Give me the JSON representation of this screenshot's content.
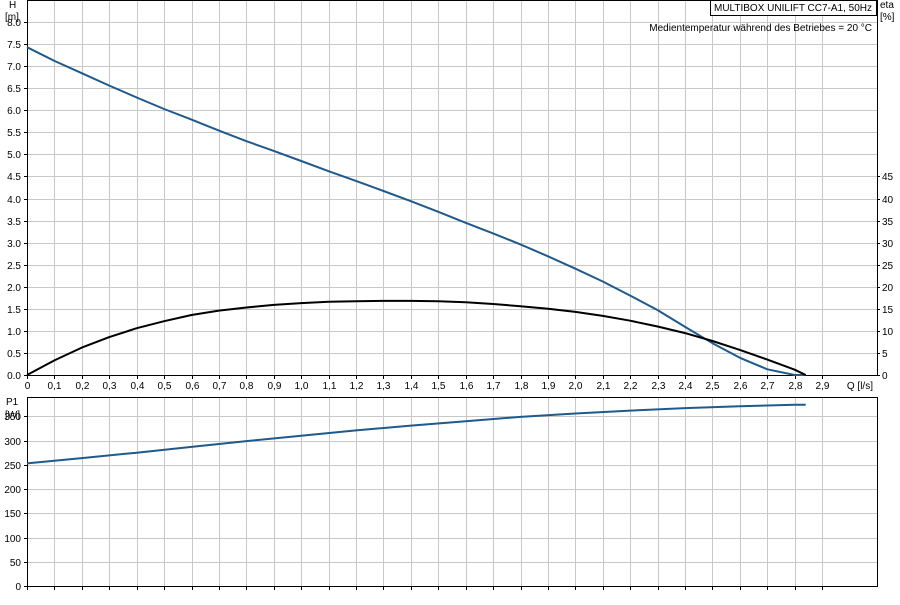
{
  "chart_data": [
    {
      "type": "line",
      "title_box": "MULTIBOX UNILIFT CC7-A1, 50Hz",
      "subtitle": "Medientemperatur während des Betriebes = 20 °C",
      "x_axis": {
        "label": "Q [l/s]",
        "range": [
          0,
          3.1
        ],
        "ticks": [
          0,
          0.1,
          0.2,
          0.3,
          0.4,
          0.5,
          0.6,
          0.7,
          0.8,
          0.9,
          1.0,
          1.1,
          1.2,
          1.3,
          1.4,
          1.5,
          1.6,
          1.7,
          1.8,
          1.9,
          2.0,
          2.1,
          2.2,
          2.3,
          2.4,
          2.5,
          2.6,
          2.7,
          2.8,
          2.9
        ],
        "tick_labels": [
          "0",
          "0,1",
          "0,2",
          "0,3",
          "0,4",
          "0,5",
          "0,6",
          "0,7",
          "0,8",
          "0,9",
          "1,0",
          "1,1",
          "1,2",
          "1,3",
          "1,4",
          "1,5",
          "1,6",
          "1,7",
          "1,8",
          "1,9",
          "2,0",
          "2,1",
          "2,2",
          "2,3",
          "2,4",
          "2,5",
          "2,6",
          "2,7",
          "2,8",
          "2,9"
        ]
      },
      "y_left": {
        "label_line1": "H",
        "label_line2": "[m]",
        "range": [
          0,
          8.5
        ],
        "ticks": [
          0,
          0.5,
          1.0,
          1.5,
          2.0,
          2.5,
          3.0,
          3.5,
          4.0,
          4.5,
          5.0,
          5.5,
          6.0,
          6.5,
          7.0,
          7.5,
          8.0
        ],
        "tick_labels": [
          "0.0",
          "0.5",
          "1.0",
          "1.5",
          "2.0",
          "2.5",
          "3.0",
          "3.5",
          "4.0",
          "4.5",
          "5.0",
          "5.5",
          "6.0",
          "6.5",
          "7.0",
          "7.5",
          "8.0"
        ]
      },
      "y_right": {
        "label_line1": "eta",
        "label_line2": "[%]",
        "range": [
          0,
          85
        ],
        "ticks": [
          0,
          5,
          10,
          15,
          20,
          25,
          30,
          35,
          40,
          45
        ],
        "tick_labels": [
          "0",
          "5",
          "10",
          "15",
          "20",
          "25",
          "30",
          "35",
          "40",
          "45"
        ]
      },
      "grid": true,
      "series": [
        {
          "axis": "left",
          "color": "#1f5a8c",
          "x": [
            0,
            0.1,
            0.2,
            0.3,
            0.4,
            0.5,
            0.6,
            0.7,
            0.8,
            0.9,
            1.0,
            1.1,
            1.2,
            1.3,
            1.4,
            1.5,
            1.6,
            1.7,
            1.8,
            1.9,
            2.0,
            2.1,
            2.2,
            2.3,
            2.4,
            2.5,
            2.6,
            2.7,
            2.8,
            2.84
          ],
          "values": [
            7.43,
            7.12,
            6.84,
            6.56,
            6.29,
            6.03,
            5.79,
            5.54,
            5.3,
            5.08,
            4.85,
            4.62,
            4.4,
            4.17,
            3.94,
            3.7,
            3.45,
            3.21,
            2.96,
            2.69,
            2.41,
            2.12,
            1.8,
            1.47,
            1.09,
            0.72,
            0.39,
            0.13,
            0.0,
            0.0
          ]
        },
        {
          "axis": "right",
          "color": "#000000",
          "x": [
            0,
            0.1,
            0.2,
            0.3,
            0.4,
            0.5,
            0.6,
            0.7,
            0.8,
            0.9,
            1.0,
            1.1,
            1.2,
            1.3,
            1.4,
            1.5,
            1.6,
            1.7,
            1.8,
            1.9,
            2.0,
            2.1,
            2.2,
            2.3,
            2.4,
            2.5,
            2.6,
            2.7,
            2.8,
            2.84
          ],
          "values": [
            0,
            3.3,
            6.2,
            8.6,
            10.6,
            12.2,
            13.6,
            14.6,
            15.3,
            15.9,
            16.3,
            16.6,
            16.7,
            16.8,
            16.8,
            16.7,
            16.5,
            16.1,
            15.6,
            15.0,
            14.3,
            13.4,
            12.3,
            11.0,
            9.5,
            7.7,
            5.7,
            3.5,
            1.2,
            0
          ]
        }
      ]
    },
    {
      "type": "line",
      "x_axis": {
        "range": [
          0,
          3.1
        ]
      },
      "y_left": {
        "label_line1": "P1",
        "label_line2": "[W]",
        "range": [
          0,
          390
        ],
        "ticks": [
          0,
          50,
          100,
          150,
          200,
          250,
          300,
          350
        ],
        "tick_labels": [
          "0",
          "50",
          "100",
          "150",
          "200",
          "250",
          "300",
          "350"
        ]
      },
      "grid": true,
      "series": [
        {
          "axis": "left",
          "color": "#1f5a8c",
          "x": [
            0,
            0.2,
            0.4,
            0.6,
            0.8,
            1.0,
            1.2,
            1.4,
            1.6,
            1.8,
            2.0,
            2.2,
            2.4,
            2.6,
            2.8,
            2.84
          ],
          "values": [
            253,
            264,
            275,
            287,
            299,
            310,
            321,
            331,
            340,
            349,
            356,
            362,
            367,
            371,
            374,
            374
          ]
        }
      ]
    }
  ]
}
